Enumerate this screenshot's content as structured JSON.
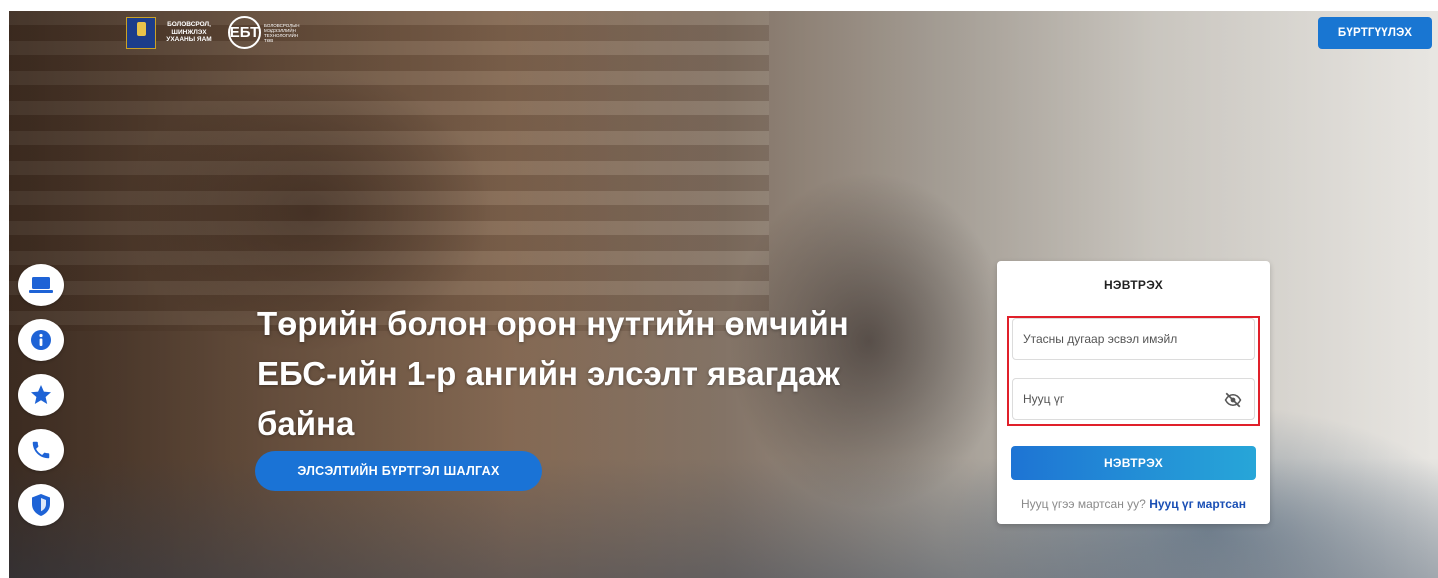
{
  "header": {
    "logo_ministry_text": "БОЛОВСРОЛ, ШИНЖЛЭХ УХААНЫ ЯАМ",
    "logo_ebt_mark": "ЕБТ",
    "logo_ebt_text": "БОЛОВСРОЛЫН МЭДЭЭЛЛИЙН ТЕХНОЛОГИЙН ТӨВ",
    "register_label": "БҮРТГҮҮЛЭХ"
  },
  "sidebar": {
    "items": [
      {
        "icon": "laptop-icon"
      },
      {
        "icon": "info-icon"
      },
      {
        "icon": "star-icon"
      },
      {
        "icon": "phone-icon"
      },
      {
        "icon": "shield-icon"
      }
    ]
  },
  "hero": {
    "line1": "Төрийн болон орон нутгийн өмчийн",
    "line2": "ЕБС-ийн 1-р ангийн элсэлт явагдаж",
    "line3": "байна",
    "check_button_label": "ЭЛСЭЛТИЙН БҮРТГЭЛ ШАЛГАХ"
  },
  "login": {
    "title": "НЭВТРЭХ",
    "username_placeholder": "Утасны дугаар эсвэл имэйл",
    "username_value": "",
    "password_placeholder": "Нууц үг",
    "password_value": "",
    "submit_label": "НЭВТРЭХ",
    "forgot_prompt": "Нууц үгээ мартсан уу?",
    "forgot_link": "Нууц үг мартсан"
  },
  "colors": {
    "primary": "#1976d2",
    "highlight": "#e0202a",
    "sidebar_icon": "#1e63d6"
  }
}
